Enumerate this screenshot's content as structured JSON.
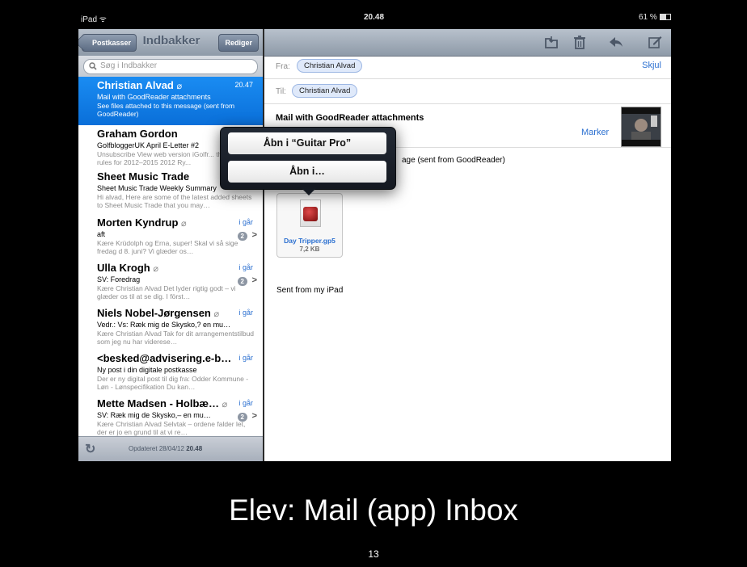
{
  "status_bar": {
    "device": "iPad",
    "time": "20.48",
    "battery": "61 %"
  },
  "left_pane": {
    "back_label": "Postkasser",
    "title": "Indbakker",
    "edit_label": "Rediger",
    "search_placeholder": "Søg i Indbakker",
    "mails": [
      {
        "sender": "Christian Alvad",
        "time": "20.47",
        "subject": "Mail with GoodReader attachments",
        "preview": "See files attached to this message (sent from GoodReader)",
        "attachment": true,
        "selected": true
      },
      {
        "sender": "Graham Gordon",
        "time": "",
        "subject": "GolfbloggerUK April E-Letter #2",
        "preview": "Unsubscribe View web version iGolfr... the new rules for 2012–2015 2012 Ry...",
        "attachment": false
      },
      {
        "sender": "Sheet Music Trade",
        "time": "",
        "subject": "Sheet Music Trade Weekly Summary",
        "preview": "Hi alvad, Here are some of the latest added sheets to Sheet Music Trade that you may…",
        "attachment": false
      },
      {
        "sender": "Morten Kyndrup",
        "time": "i går",
        "subject": "aft",
        "preview": "Kære Krüdolph og Erna, super! Skal vi så sige fredag d 8. juni? Vi glæder os…",
        "attachment": true,
        "badge": "2"
      },
      {
        "sender": "Ulla Krogh",
        "time": "i går",
        "subject": "SV: Foredrag",
        "preview": "Kære Christian Alvad Det lyder rigtig godt – vi glæder os til at se dig. I först…",
        "attachment": true,
        "badge": "2"
      },
      {
        "sender": "Niels Nobel-Jørgensen",
        "time": "i går",
        "subject": "Vedr.: Vs: Ræk mig de Skysko,? en mu…",
        "preview": "Kære Christian Alvad Tak for dit arrangementstilbud som jeg nu har viderese…",
        "attachment": true
      },
      {
        "sender": "<besked@advisering.e-b…",
        "time": "i går",
        "subject": "Ny post i din digitale postkasse",
        "preview": "Der er ny digital post til dig fra: Odder Kommune - Løn - Lønspecifikation Du kan…",
        "attachment": false
      },
      {
        "sender": "Mette Madsen - Holbæ…",
        "time": "i går",
        "subject": "SV: Ræk mig de Skysko,– en mu…",
        "preview": "Kære Christian Alvad Selvtak – ordene falder let, der er jo en grund til at vi re…",
        "attachment": true,
        "badge": "2"
      }
    ],
    "updated_label": "Opdateret",
    "updated_date": "28/04/12",
    "updated_time": "20.48"
  },
  "message": {
    "from_label": "Fra:",
    "from": "Christian Alvad",
    "hide_label": "Skjul",
    "to_label": "Til:",
    "to": "Christian Alvad",
    "subject": "Mail with GoodReader attachments",
    "mark_label": "Marker",
    "body_visible": "age (sent from GoodReader)",
    "attachment_name": "Day Tripper.gp5",
    "attachment_size": "7,2 KB",
    "signature": "Sent from my iPad"
  },
  "popover": {
    "option1": "Åbn i “Guitar Pro”",
    "option2": "Åbn i…"
  },
  "caption": "Elev: Mail (app) Inbox",
  "slide_number": "13"
}
